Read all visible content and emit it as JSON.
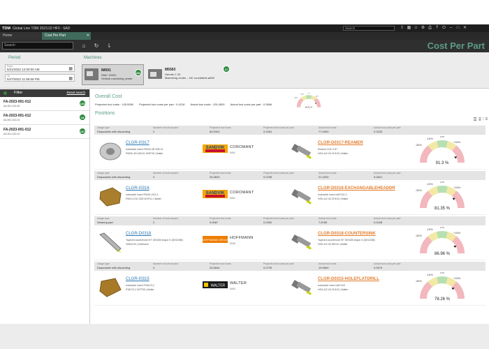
{
  "titlebar": {
    "brand": "TDM",
    "title": "Global Line   TDM 2023.02 HF0 - SAD",
    "search_placeholder": "Search"
  },
  "tabs": [
    {
      "label": "Home"
    },
    {
      "label": "Cost Per Part",
      "close": "✕"
    }
  ],
  "toolbar": {
    "search_placeholder": "Search",
    "page_title": "Cost Per Part"
  },
  "period": {
    "label": "Period",
    "from_label": "From",
    "from_value": "5/21/2022 12:00:00 AM",
    "to_label": "To",
    "to_value": "5/27/2022 11:59:59 PM"
  },
  "machines": {
    "label": "Machines",
    "items": [
      {
        "name": "IM001",
        "desc1": "DMC 1150V",
        "desc2": "Vertical machining center",
        "count": "304"
      },
      {
        "name": "M5563",
        "desc1": "Hermle C 32",
        "desc2": "Machining center – NC roundtable,ø650",
        "count": "17"
      }
    ]
  },
  "filter": {
    "title": "Filter",
    "reset": "Reset search",
    "items": [
      {
        "title": "FA-2023-001-012",
        "sub": "A4-001-012-00",
        "count": "143"
      },
      {
        "title": "FA-2023-001-012",
        "sub": "A4-001-012-01",
        "count": "13"
      },
      {
        "title": "FA-2023-001-012",
        "sub": "A4-001-012-01",
        "count": "107"
      }
    ]
  },
  "overall": {
    "title": "Overall Cost",
    "projected_label": "Projected tool costs :",
    "projected_value": "145.5080",
    "projected_per_part_label": "Projected tool costs per part :",
    "projected_per_part_value": "0.4218",
    "actual_label": "Actual tool costs :",
    "actual_value": "126.4500",
    "actual_per_part_label": "Actual tool costs per part :",
    "actual_per_part_value": "0.3666",
    "gauge": {
      "value": "86.91 %",
      "fraction": 0.87
    }
  },
  "positions": {
    "title": "Positions",
    "col_labels": {
      "usage": "Usage type",
      "issued": "Number of tools issued",
      "projected": "Projected tool costs",
      "projected_pp": "Projected tool costs per part",
      "actual": "Actual tool costs",
      "actual_pp": "Actual tool costs per part"
    },
    "items": [
      {
        "usage": "Disposable with discarding",
        "issued": "2",
        "projected": "84.5324",
        "projected_pp": "0.2451",
        "actual": "77.0000",
        "actual_pp": "0.2233",
        "code": "CLGR-I0317",
        "sub1": "Indexable insert P6000-4R-008-01",
        "sub2": "P6000-4R-008-01 WSP35 | Walter",
        "brand": "SANDVIK",
        "brand_name": "COROMANT",
        "brand_code": "0001",
        "holder": "CLGR-D0317-REAMER",
        "holder_sub1": "Reamer D31.3 H7",
        "holder_sub2": "HSK-A/C 63 ZH100 | Walter",
        "gauge": {
          "value": "91.3 %",
          "fraction": 0.91
        },
        "insert_color": "#c9c9c9",
        "insert_shape": "ring"
      },
      {
        "usage": "Disposable with discarding",
        "issued": "2",
        "projected": "26.3623",
        "projected_pp": "0.0765",
        "actual": "21.4200",
        "actual_pp": "0.0621",
        "code": "CLGR-I0316",
        "sub1": "Indexable insert P6001-D31.3",
        "sub2": "P6001-D31.3G8 WXP41 | Walter",
        "brand": "SANDVIK",
        "brand_name": "COROMANT",
        "brand_code": "0001",
        "holder": "CLGR-D0316-EXCHANGABLEHEADDR",
        "holder_sub1": "Indexable insert drill D31.3",
        "holder_sub2": "HSK-A/C 63 ZH100 | Walter",
        "gauge": {
          "value": "81.35 %",
          "fraction": 0.81
        },
        "insert_color": "#a97f2e",
        "insert_shape": "hex"
      },
      {
        "usage": "Wearing part",
        "issued": "2",
        "projected": "9.0087",
        "projected_pp": "0.0262",
        "actual": "7.8780",
        "actual_pp": "0.0228",
        "code": "CLGR-D0318",
        "sub1": "Tapered countersink 90° DIN335 shape D (DIN2288)",
        "sub2": "30818-90 | Hoffmann",
        "brand": "HOFFMANN GROUP",
        "brand_name": "HOFFMANN",
        "brand_code": "0045",
        "holder": "CLGR-D0318-COUNTERSINK",
        "holder_sub1": "Tapered countersink 90° DIN335 shape D (DIN2288)",
        "holder_sub2": "HSK-A/C 63 WD16 | Walter",
        "gauge": {
          "value": "86.96 %",
          "fraction": 0.87
        },
        "insert_color": "#b5b5b5",
        "insert_shape": "drill"
      },
      {
        "usage": "Disposable with discarding",
        "issued": "4",
        "projected": "25.5844",
        "projected_pp": "0.0739",
        "actual": "19.9600",
        "actual_pp": "0.0579",
        "code": "CLGR-I0315",
        "sub1": "Indexable insert P28473-2",
        "sub2": "P28473-2 WTP35 | Walter",
        "brand": "WALTER",
        "brand_name": "WALTER",
        "brand_code": "0003",
        "holder": "CLGR-D0315-HOLEFLATDRILL",
        "holder_sub1": "Indexable insert drill D18",
        "holder_sub2": "HSK-A/C 63 ZH100 | Walter",
        "gauge": {
          "value": "78.26 %",
          "fraction": 0.78
        },
        "insert_color": "#a87a28",
        "insert_shape": "square"
      }
    ]
  },
  "gauge_scale": {
    "minus30": "-30%",
    "minus15": "-15%",
    "zero": "0%",
    "plus15": "+15%"
  },
  "colors": {
    "accent": "#5c9c87",
    "badge": "#2e8b3e",
    "link": "#2a76b3",
    "holder_link": "#e27c2c"
  }
}
